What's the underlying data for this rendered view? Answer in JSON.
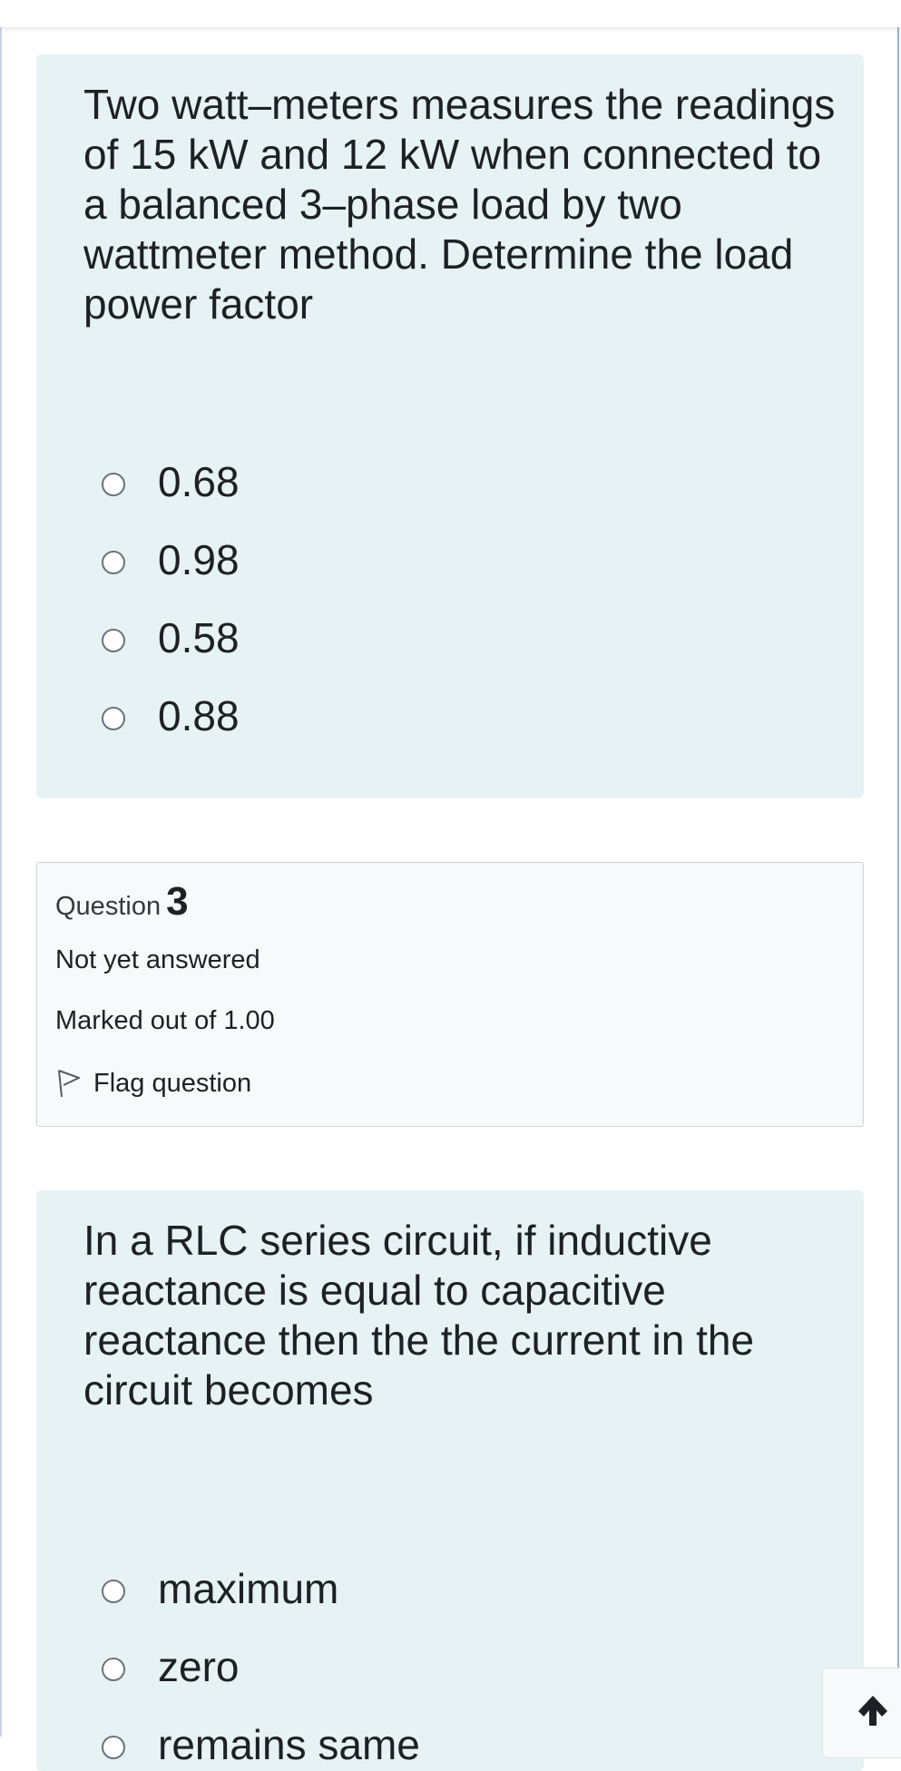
{
  "questions": [
    {
      "text": "Two watt–meters measures the readings of 15 kW and 12 kW when connected to a balanced 3–phase load by two wattmeter method. Determine the load power factor",
      "answers": [
        "0.68",
        "0.98",
        "0.58",
        "0.88"
      ]
    },
    {
      "info": {
        "question_word": "Question",
        "question_number": "3",
        "status": "Not yet answered",
        "marks": "Marked out of 1.00",
        "flag_label": "Flag question"
      },
      "text": "In a RLC series circuit, if inductive reactance is equal to capacitive reactance then the the current in the circuit becomes",
      "answers": [
        "maximum",
        "zero",
        "remains same"
      ]
    }
  ],
  "icons": {
    "radio": "radio-unchecked-icon",
    "flag": "flag-outline-icon",
    "back_to_top": "arrow-up-icon"
  },
  "colors": {
    "qtext_background": "#e7f2f4",
    "info_background": "#f8f9fa",
    "info_border": "#cfd3d7",
    "text": "#1d2125",
    "radio_border": "#6a737b"
  }
}
